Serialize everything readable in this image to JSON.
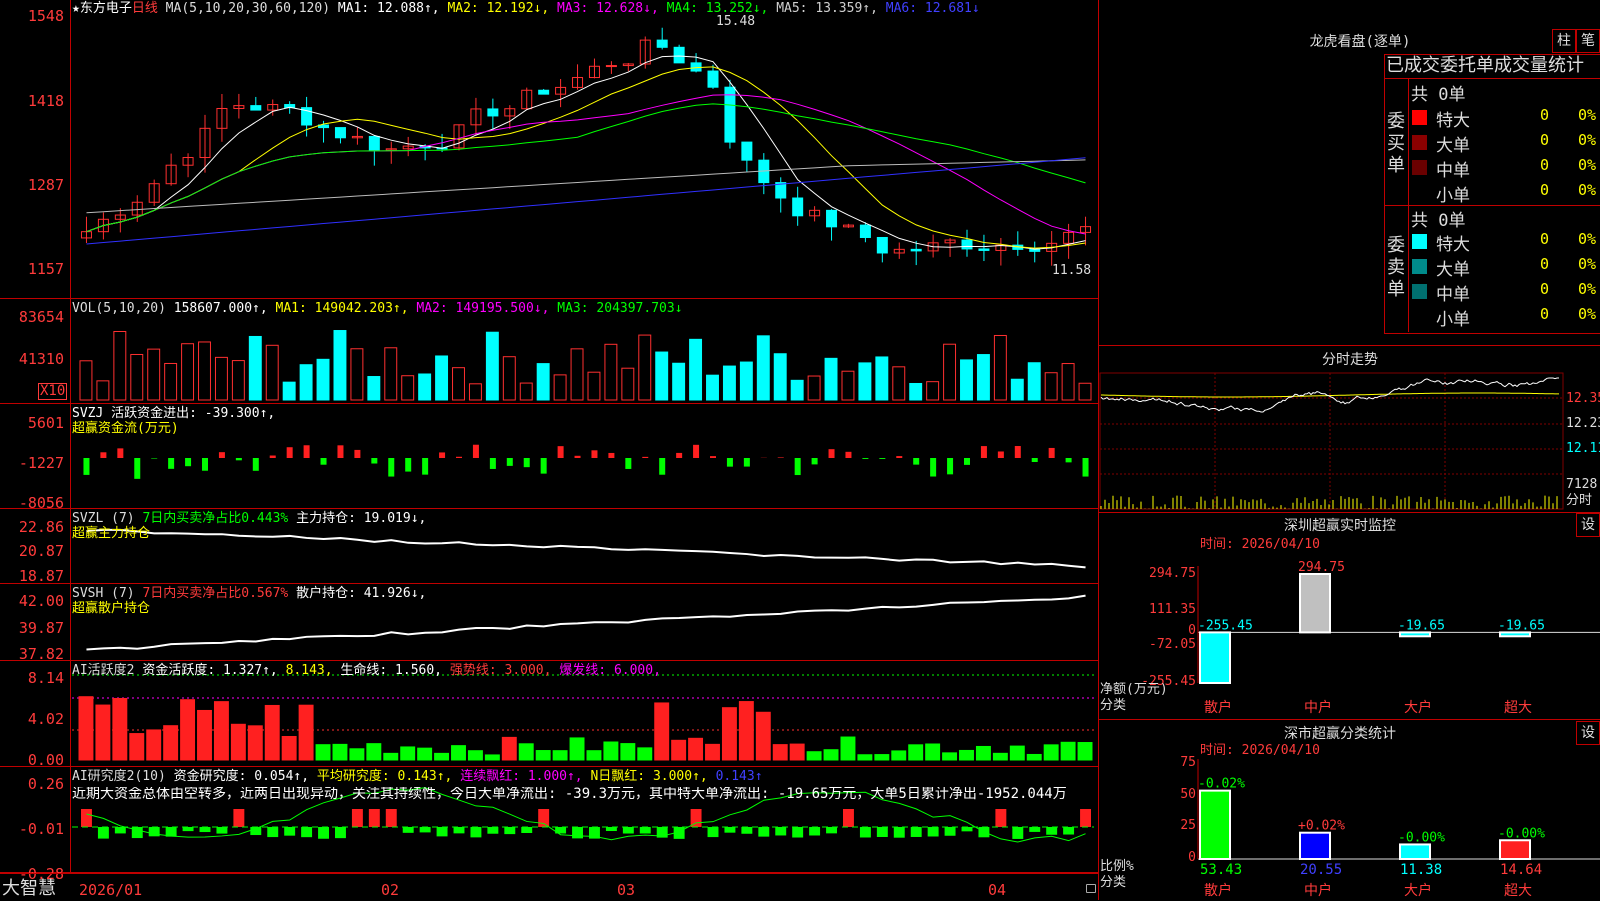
{
  "stock": {
    "prefix": "★东方电子",
    "period": "日线"
  },
  "ma_line": {
    "label": "MA(5,10,20,30,60,120)",
    "ma1": "MA1: 12.088↑,",
    "ma2": "MA2: 12.192↓,",
    "ma3": "MA3: 12.628↓,",
    "ma4": "MA4: 13.252↓,",
    "ma5": "MA5: 13.359↑,",
    "ma6": "MA6: 12.681↓"
  },
  "price_axis": {
    "t1": "1548",
    "t2": "1418",
    "t3": "1287",
    "t4": "1157"
  },
  "price_marks": {
    "high": "15.48",
    "low": "11.58"
  },
  "vol": {
    "label": "VOL(5,10,20)",
    "val": "158607.000↑,",
    "ma1": "MA1: 149042.203↑,",
    "ma2": "MA2: 149195.500↓,",
    "ma3": "MA3: 204397.703↓",
    "axis": {
      "t1": "83654",
      "t2": "41310",
      "unit": "X10"
    }
  },
  "svzj": {
    "label": "SVZJ  活跃资金进出: -39.300↑,",
    "sub": "超赢资金流(万元)",
    "axis": {
      "t1": "5601",
      "t2": "-1227",
      "t3": "-8056"
    }
  },
  "svzl": {
    "label": "SVZL (7)",
    "ratio": "7日内买卖净占比0.443%",
    "hold": "主力持仓: 19.019↓,",
    "sub": "超赢主力持仓",
    "axis": {
      "t1": "22.86",
      "t2": "20.87",
      "t3": "18.87"
    }
  },
  "svsh": {
    "label": "SVSH (7)",
    "ratio": "7日内买卖净占比0.567%",
    "hold": "散户持仓: 41.926↓,",
    "sub": "超赢散户持仓",
    "axis": {
      "t1": "42.00",
      "t2": "39.87",
      "t3": "37.82"
    }
  },
  "ai_active": {
    "label": "AI活跃度2",
    "fund": "资金活跃度: 1.327↑,",
    "val2": "8.143,",
    "life": "生命线: 1.560,",
    "strong": "强势线: 3.000,",
    "burst": "爆发线: 6.000,",
    "axis": {
      "t1": "8.14",
      "t2": "4.02",
      "t3": "0.00"
    }
  },
  "ai_research": {
    "label": "AI研究度2(10)",
    "fund": "资金研究度: 0.054↑,",
    "avg": "平均研究度: 0.143↑,",
    "consec": "连续飘红: 1.000↑,",
    "nday": "N日飘红: 3.000↑,",
    "last": "0.143↑",
    "comment": "近期大资金总体由空转多，近两日出现异动，关注其持续性，今日大单净流出: -39.3万元，其中特大单净流出: -19.65万元，大单5日累计净出-1952.044万",
    "axis": {
      "t1": "0.26",
      "t2": "-0.01",
      "t3": "-0.28"
    }
  },
  "x_axis": {
    "a": "2026/01",
    "b": "02",
    "c": "03",
    "d": "04"
  },
  "brand": "大智慧",
  "right": {
    "lhb_title": "龙虎看盘(逐单)",
    "btn_zhu": "柱",
    "btn_bi": "笔",
    "table_title": "已成交委托单成交量统计",
    "buy_group": "委买单",
    "sell_group": "委卖单",
    "buy_total": "共 0单",
    "sell_total": "共 0单",
    "buy_rows": [
      {
        "label": "特大",
        "num": "0",
        "pct": "0%",
        "color": "#ff0000"
      },
      {
        "label": "大单",
        "num": "0",
        "pct": "0%",
        "color": "#8b0000"
      },
      {
        "label": "中单",
        "num": "0",
        "pct": "0%",
        "color": "#6a0000"
      },
      {
        "label": "小单",
        "num": "0",
        "pct": "0%",
        "color": "#000000"
      }
    ],
    "sell_rows": [
      {
        "label": "特大",
        "num": "0",
        "pct": "0%",
        "color": "#00ffff"
      },
      {
        "label": "大单",
        "num": "0",
        "pct": "0%",
        "color": "#008b8b"
      },
      {
        "label": "中单",
        "num": "0",
        "pct": "0%",
        "color": "#007070"
      },
      {
        "label": "小单",
        "num": "0",
        "pct": "0%",
        "color": "#000000"
      }
    ],
    "minute_title": "分时走势",
    "minute_axis": {
      "t1": "12.35",
      "t2": "12.23",
      "t3": "12.11",
      "vol": "7128",
      "unit": "分时"
    },
    "sz_monitor_title": "深圳超赢实时监控",
    "sz_monitor_btn": "设",
    "sz_monitor_time": "时间: 2026/04/10",
    "sz_monitor_axis": {
      "t1": "294.75",
      "t2": "111.35",
      "t3": "0",
      "t4": "-72.05",
      "t5": "-255.45"
    },
    "sz_monitor_yname": "净额(万元)",
    "sz_monitor_xname": "分类",
    "sz_monitor_bars": [
      {
        "cat": "散户",
        "value": -255.45,
        "label": "-255.45"
      },
      {
        "cat": "中户",
        "value": 294.75,
        "label": "294.75"
      },
      {
        "cat": "大户",
        "value": -19.65,
        "label": "-19.65"
      },
      {
        "cat": "超大",
        "value": -19.65,
        "label": "-19.65"
      }
    ],
    "sz_stat_title": "深市超赢分类统计",
    "sz_stat_btn": "设",
    "sz_stat_time": "时间: 2026/04/10",
    "sz_stat_axis": {
      "t1": "75",
      "t2": "50",
      "t3": "25",
      "t4": "0"
    },
    "sz_stat_yname": "比例%",
    "sz_stat_xname": "分类",
    "sz_stat_bars": [
      {
        "cat": "散户",
        "value": 53.43,
        "label": "53.43",
        "chg": "-0.02%"
      },
      {
        "cat": "中户",
        "value": 20.55,
        "label": "20.55",
        "chg": "+0.02%"
      },
      {
        "cat": "大户",
        "value": 11.38,
        "label": "11.38",
        "chg": "-0.00%"
      },
      {
        "cat": "超大",
        "value": 14.64,
        "label": "14.64",
        "chg": "-0.00%"
      }
    ]
  }
}
